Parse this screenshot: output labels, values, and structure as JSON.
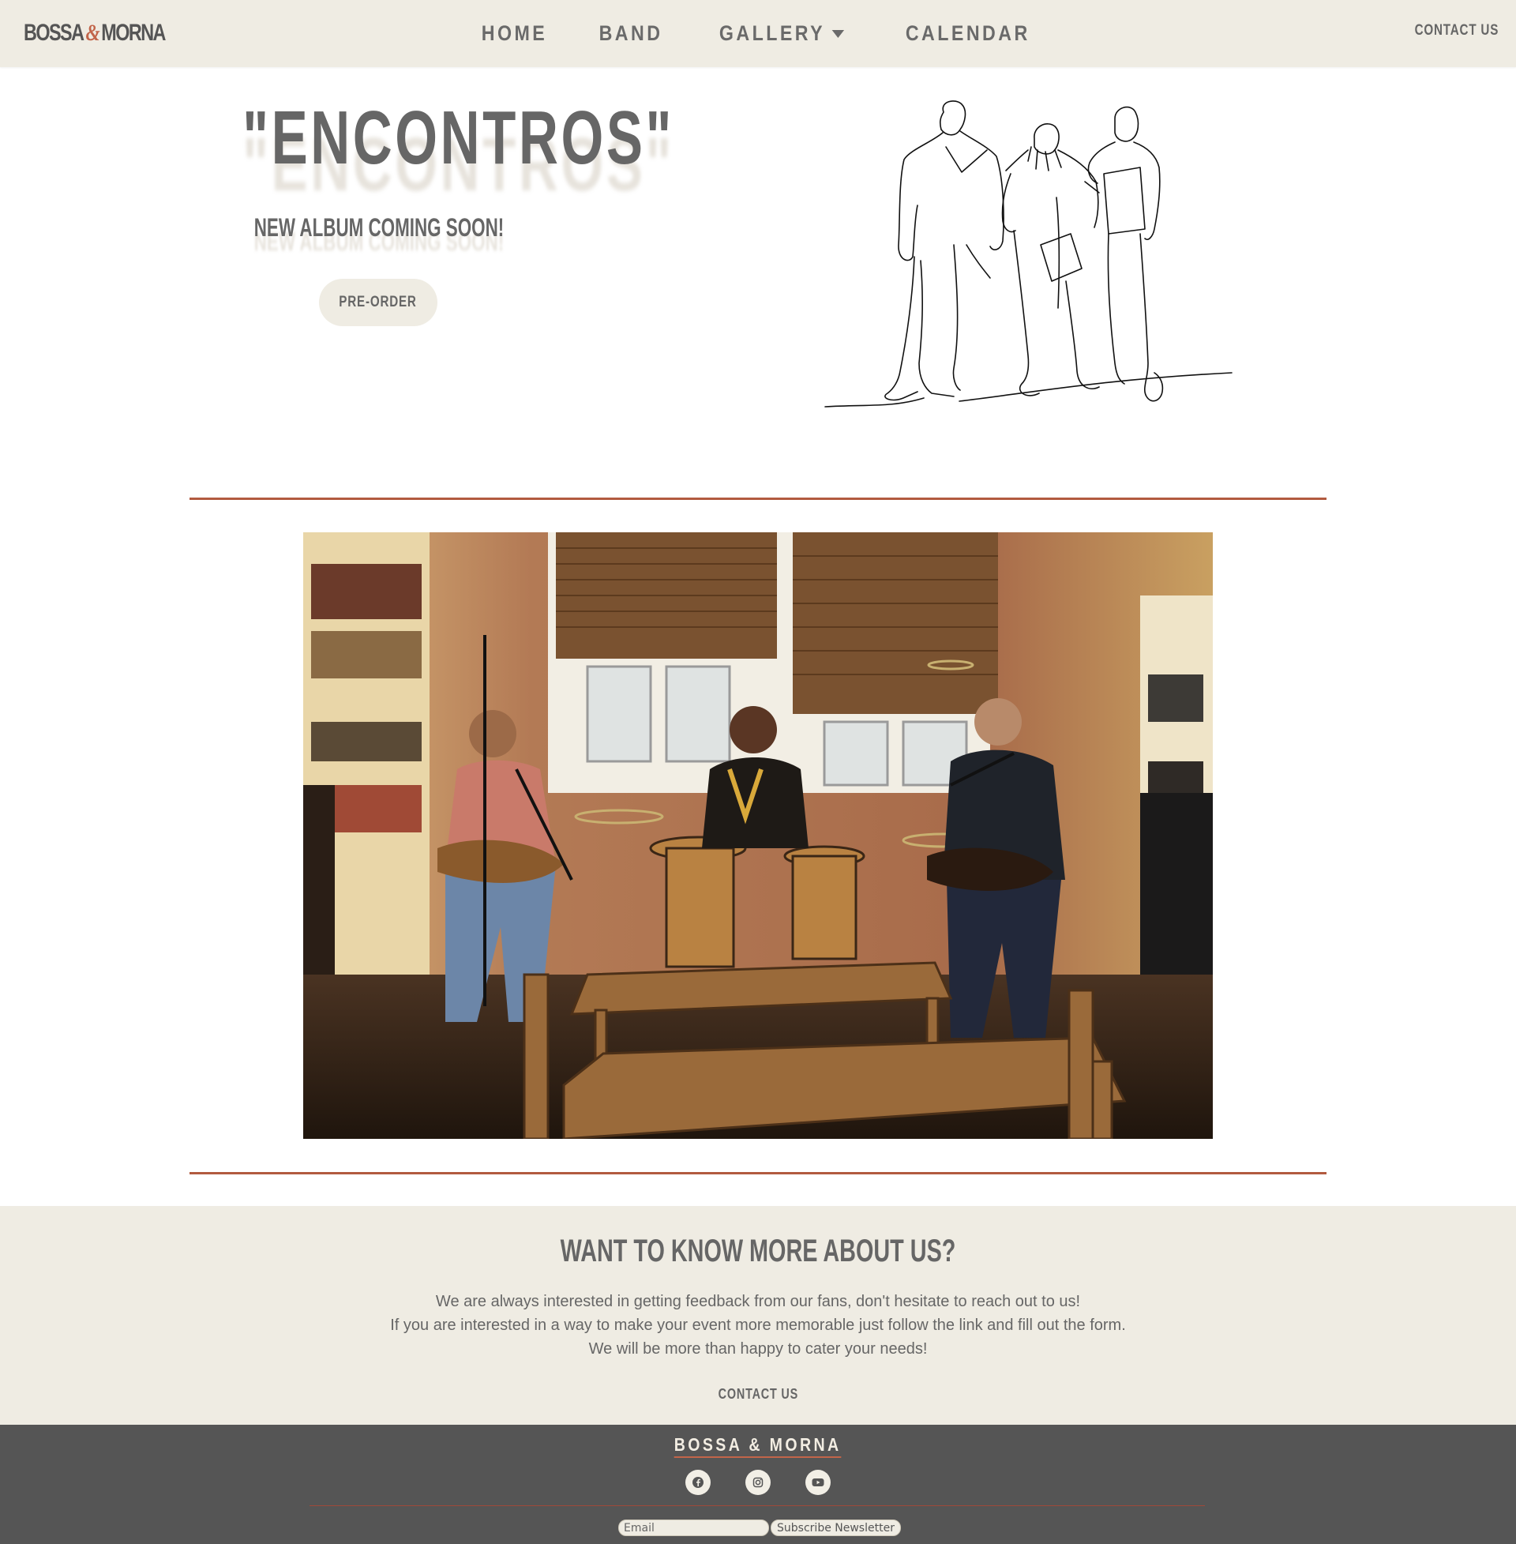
{
  "navbar": {
    "logo_left": "BOSSA",
    "logo_amp": "&",
    "logo_right": "MORNA",
    "links": [
      "HOME",
      "BAND",
      "GALLERY",
      "CALENDAR"
    ],
    "contact": "CONTACT US"
  },
  "hero": {
    "title": "\"ENCONTROS\"",
    "subtitle": "NEW ALBUM COMING SOON!",
    "button": "PRE-ORDER"
  },
  "about": {
    "title": "WANT TO KNOW MORE ABOUT US?",
    "lines": [
      "We are always interested in getting feedback from our fans, don't hesitate to reach out to us!",
      "If you are interested in a way to make your event more memorable just follow the link and fill out the form.",
      "We will be more than happy to cater your needs!"
    ],
    "contact": "CONTACT US"
  },
  "footer": {
    "brand": "BOSSA & MORNA",
    "social_icons": [
      "facebook-icon",
      "instagram-icon",
      "youtube-icon"
    ],
    "email_placeholder": "Email",
    "subscribe_label": "Subscribe Newsletter"
  },
  "colors": {
    "cream": "#efece3",
    "accent": "#b25a3f",
    "text": "#666666",
    "footer_bg": "#555555"
  }
}
